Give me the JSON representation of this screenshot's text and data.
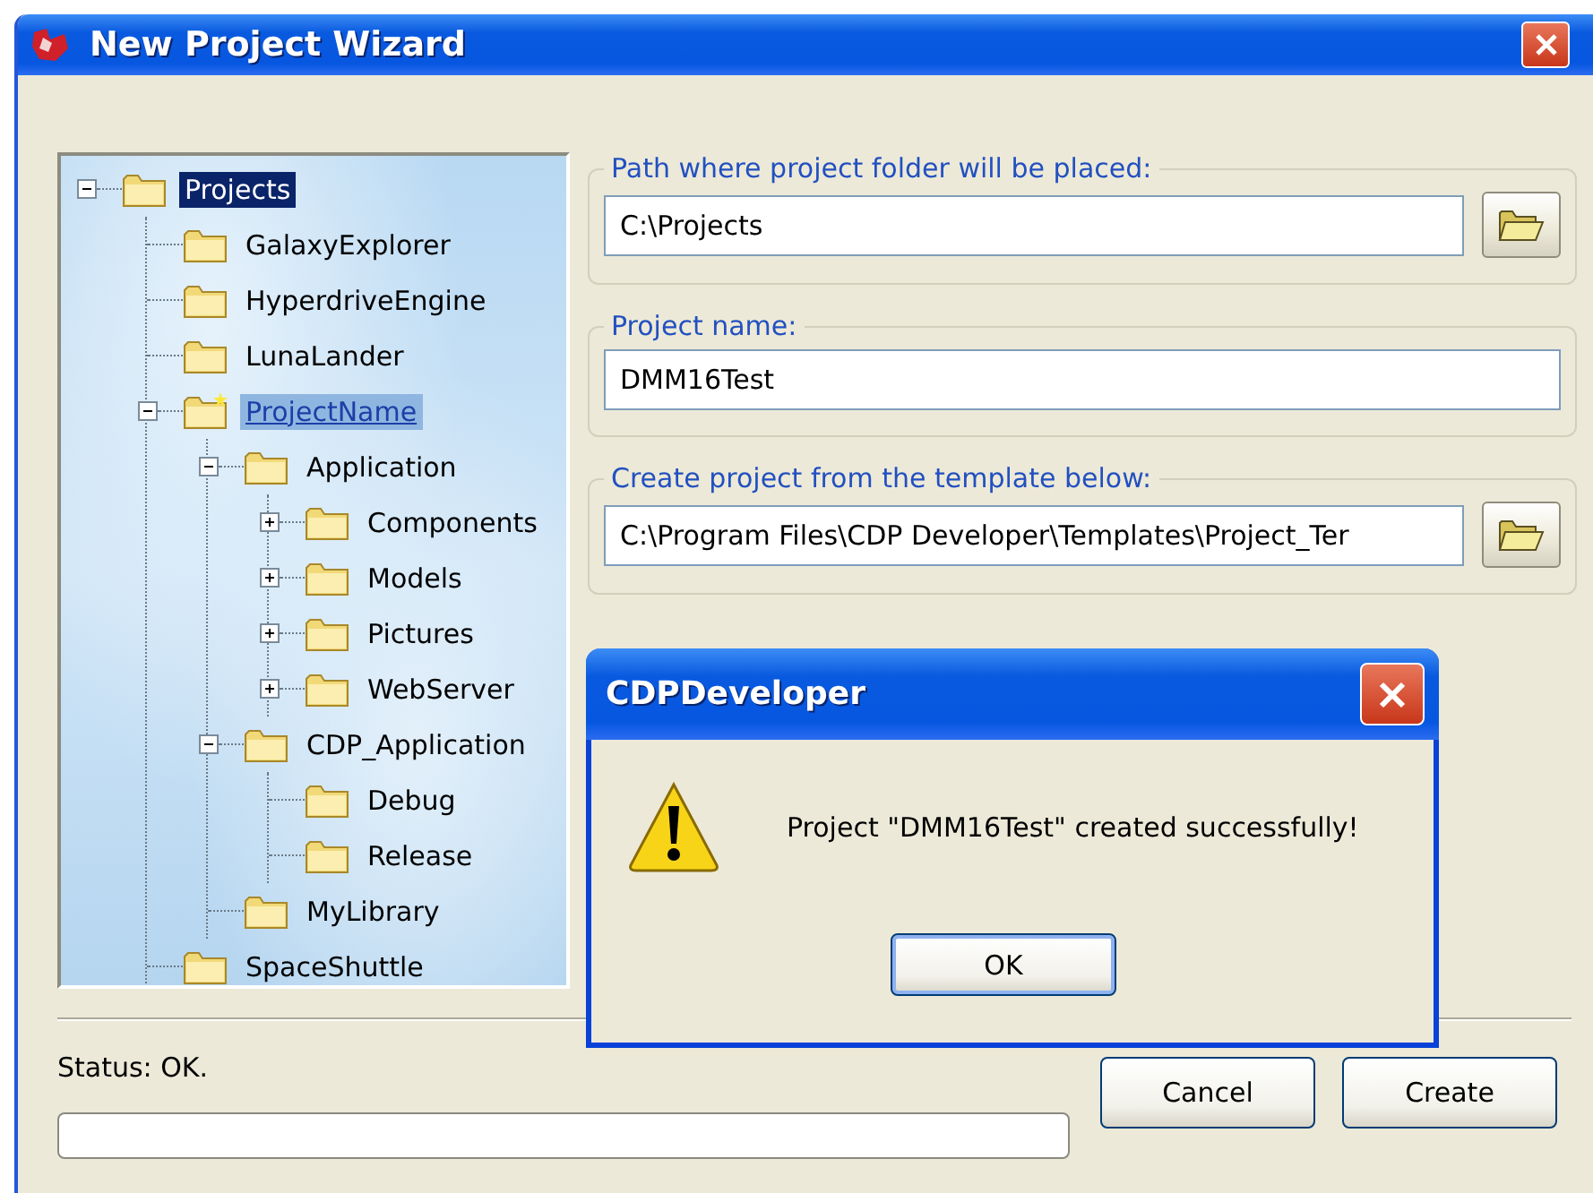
{
  "window": {
    "title": "New Project Wizard"
  },
  "tree": [
    {
      "label": "Projects",
      "selected": true,
      "hot": false,
      "new": false,
      "expanded": true,
      "children": [
        {
          "label": "GalaxyExplorer",
          "selected": false,
          "hot": false,
          "new": false
        },
        {
          "label": "HyperdriveEngine",
          "selected": false,
          "hot": false,
          "new": false
        },
        {
          "label": "LunaLander",
          "selected": false,
          "hot": false,
          "new": false
        },
        {
          "label": "ProjectName",
          "selected": false,
          "hot": true,
          "new": true,
          "expanded": true,
          "children": [
            {
              "label": "Application",
              "selected": false,
              "hot": false,
              "new": false,
              "expanded": true,
              "children": [
                {
                  "label": "Components",
                  "selected": false,
                  "hot": false,
                  "new": false,
                  "expanded": false
                },
                {
                  "label": "Models",
                  "selected": false,
                  "hot": false,
                  "new": false,
                  "expanded": false
                },
                {
                  "label": "Pictures",
                  "selected": false,
                  "hot": false,
                  "new": false,
                  "expanded": false
                },
                {
                  "label": "WebServer",
                  "selected": false,
                  "hot": false,
                  "new": false,
                  "expanded": false
                }
              ]
            },
            {
              "label": "CDP_Application",
              "selected": false,
              "hot": false,
              "new": false,
              "expanded": true,
              "children": [
                {
                  "label": "Debug",
                  "selected": false,
                  "hot": false,
                  "new": false
                },
                {
                  "label": "Release",
                  "selected": false,
                  "hot": false,
                  "new": false
                }
              ]
            },
            {
              "label": "MyLibrary",
              "selected": false,
              "hot": false,
              "new": false
            }
          ]
        },
        {
          "label": "SpaceShuttle",
          "selected": false,
          "hot": false,
          "new": false
        }
      ]
    }
  ],
  "fields": [
    {
      "label": "Path where project folder will be placed:",
      "value": "C:\\Projects",
      "browse": true
    },
    {
      "label": "Project name:",
      "value": "DMM16Test",
      "browse": false
    },
    {
      "label": "Create project from the template below:",
      "value": "C:\\Program Files\\CDP Developer\\Templates\\Project_Ter",
      "browse": true
    }
  ],
  "status": "Status: OK.",
  "progress": {
    "level": 0
  },
  "buttons": [
    {
      "label": "Cancel"
    },
    {
      "label": "Create"
    }
  ],
  "dialog": {
    "title": "CDPDeveloper",
    "kind": "warning",
    "message": "Project \"DMM16Test\" created successfully!",
    "buttons": [
      {
        "label": "OK",
        "default": true
      }
    ]
  }
}
